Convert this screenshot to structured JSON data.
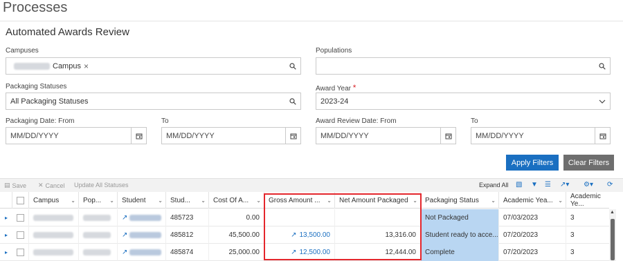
{
  "page": {
    "title": "Processes"
  },
  "filters": {
    "section_title": "Automated Awards Review",
    "campuses": {
      "label": "Campuses",
      "chip_text": "Campus",
      "chip_remove": "×"
    },
    "populations": {
      "label": "Populations",
      "value": ""
    },
    "packaging_statuses": {
      "label": "Packaging Statuses",
      "value": "All Packaging Statuses"
    },
    "award_year": {
      "label": "Award Year",
      "required_mark": "*",
      "value": "2023-24"
    },
    "packaging_date_from": {
      "label": "Packaging Date: From",
      "placeholder": "MM/DD/YYYY"
    },
    "packaging_date_to": {
      "label": "To",
      "placeholder": "MM/DD/YYYY"
    },
    "award_review_from": {
      "label": "Award Review Date: From",
      "placeholder": "MM/DD/YYYY"
    },
    "award_review_to": {
      "label": "To",
      "placeholder": "MM/DD/YYYY"
    },
    "apply_label": "Apply Filters",
    "clear_label": "Clear Filters"
  },
  "toolbar": {
    "save_label": "Save",
    "cancel_label": "Cancel",
    "update_all_label": "Update All Statuses",
    "expand_all_label": "Expand All"
  },
  "grid": {
    "columns": [
      "Campus",
      "Pop...",
      "Student",
      "Stud...",
      "Cost Of A...",
      "Gross Amount ...",
      "Net Amount Packaged",
      "Packaging Status",
      "Academic Yea...",
      "Academic Ye..."
    ],
    "rows": [
      {
        "stud_id": "485723",
        "cost": "0.00",
        "gross": "",
        "net": "",
        "status": "Not Packaged",
        "acad_date": "07/03/2023",
        "acad_year": "3"
      },
      {
        "stud_id": "485812",
        "cost": "45,500.00",
        "gross": "13,500.00",
        "net": "13,316.00",
        "status": "Student ready to acce...",
        "acad_date": "07/20/2023",
        "acad_year": "3"
      },
      {
        "stud_id": "485874",
        "cost": "25,000.00",
        "gross": "12,500.00",
        "net": "12,444.00",
        "status": "Complete",
        "acad_date": "07/20/2023",
        "acad_year": "3"
      }
    ]
  },
  "colors": {
    "accent": "#1a6fc1",
    "highlight": "#e4262c",
    "status_bg": "#b9d6f2"
  }
}
